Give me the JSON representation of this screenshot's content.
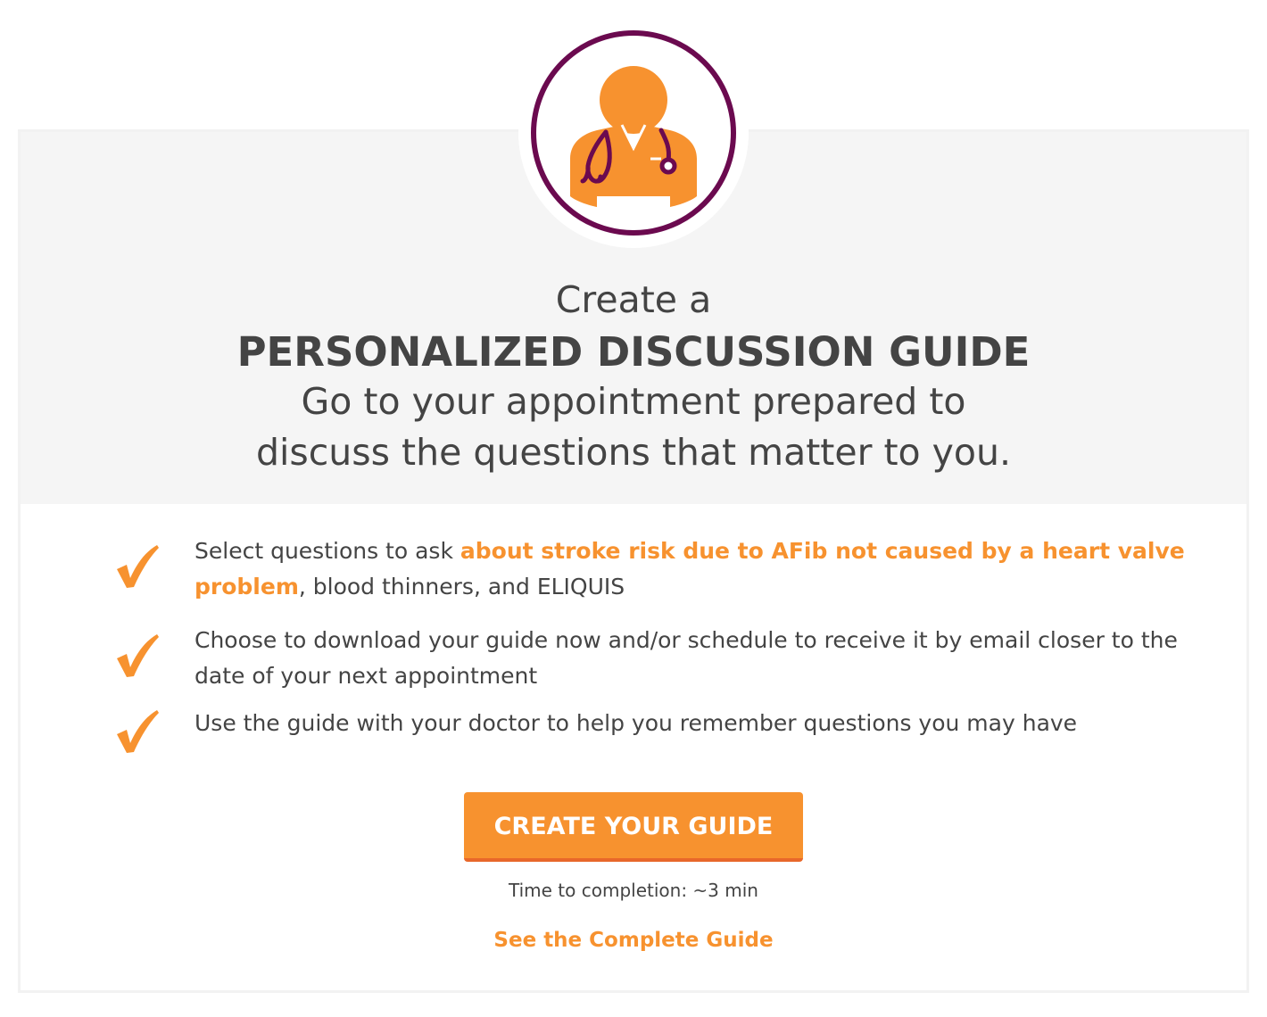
{
  "header": {
    "line1": "Create a",
    "line2": "PERSONALIZED DISCUSSION GUIDE",
    "subtitle": "Go to your appointment prepared to\ndiscuss the questions that matter to you."
  },
  "illustration": {
    "icon": "doctor-with-stethoscope-icon",
    "ring_color": "#6b0a4f",
    "figure_color": "#f7922f"
  },
  "checklist": {
    "check_icon": "checkmark-icon",
    "items": [
      {
        "before": "Select questions to ask ",
        "highlight": "about stroke risk due to AFib not caused by a heart valve problem",
        "after": ", blood thinners, and ELIQUIS"
      },
      {
        "text": "Choose to download your guide now and/or schedule to receive it by email closer to the date of your next appointment"
      },
      {
        "text": "Use the guide with your doctor to help you remember questions you may have"
      }
    ]
  },
  "cta": {
    "label": "CREATE YOUR GUIDE",
    "time_note": "Time to completion: ~3 min",
    "secondary_link": "See the Complete Guide"
  },
  "colors": {
    "accent": "#f7922f",
    "accent_dark": "#e8672a",
    "ring": "#6b0a4f",
    "panel_bg": "#f5f5f5",
    "text": "#444444"
  }
}
